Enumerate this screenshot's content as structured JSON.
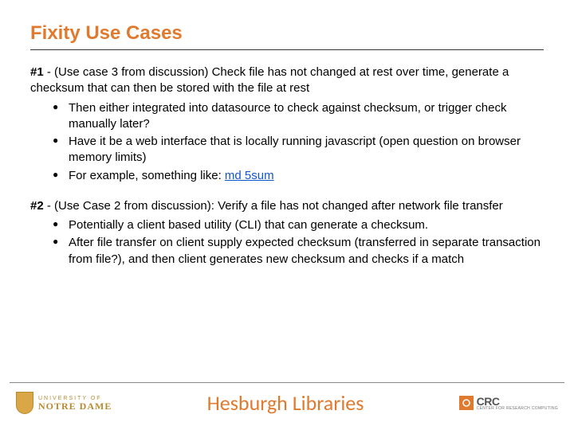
{
  "title": "Fixity Use Cases",
  "section1": {
    "lead_bold": "#1",
    "lead_rest": " - (Use case 3 from discussion) Check file has not changed at rest over time, generate a checksum that can then be stored with the file at rest",
    "bullets": [
      "Then either integrated into datasource to check against checksum, or trigger check manually later?",
      "Have it be a web interface that is locally running javascript (open question on browser memory limits)"
    ],
    "bullet3_prefix": "For example, something like: ",
    "bullet3_link": "md 5sum"
  },
  "section2": {
    "lead_bold": "#2",
    "lead_rest": " - (Use Case 2 from discussion): Verify a file has not changed after network file transfer",
    "bullets": [
      "Potentially a client based utility (CLI) that can generate a checksum.",
      "After file transfer on client supply expected checksum (transferred in separate transaction from file?), and then client generates new checksum and checks if a match"
    ]
  },
  "footer": {
    "nd_small": "UNIVERSITY OF",
    "nd_big": "NOTRE DAME",
    "center": "Hesburgh Libraries",
    "crc_big": "CRC",
    "crc_small": "CENTER FOR RESEARCH COMPUTING"
  }
}
